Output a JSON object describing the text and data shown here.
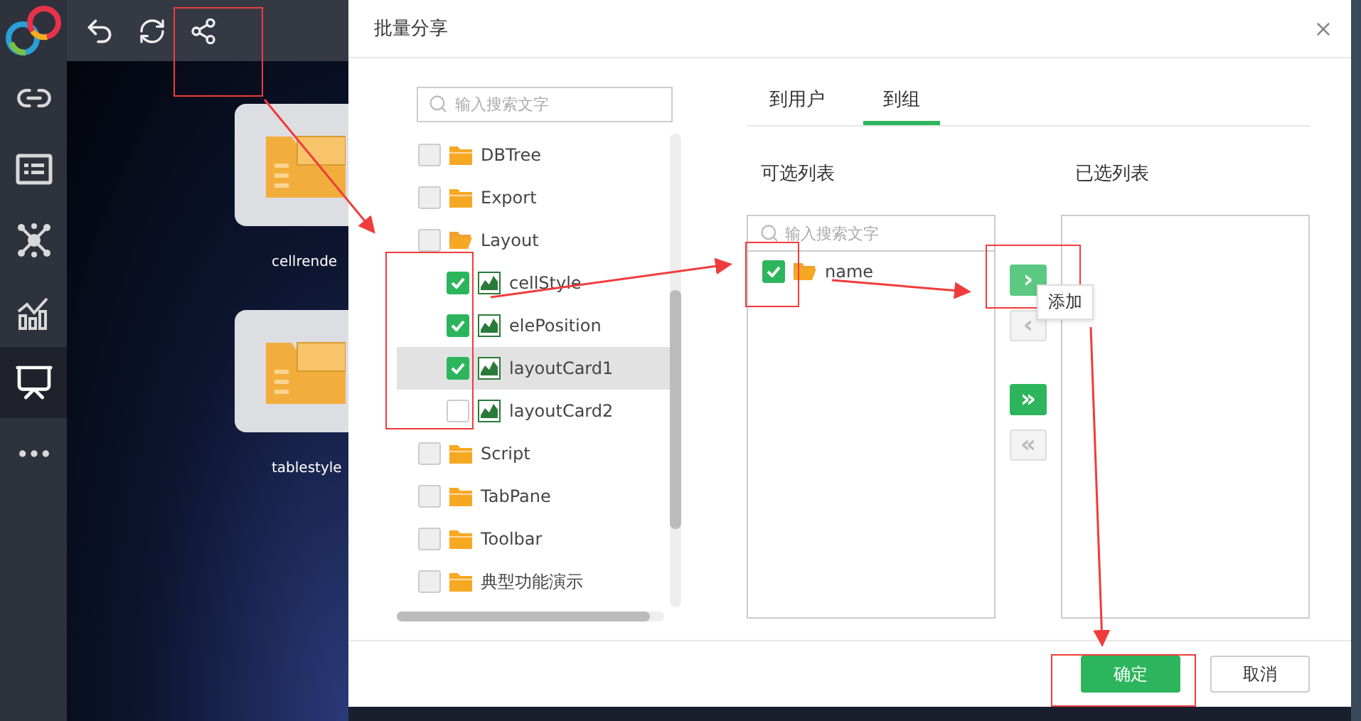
{
  "sidebar": {
    "items": [
      {
        "kind": "link",
        "selected": false
      },
      {
        "kind": "form",
        "selected": false
      },
      {
        "kind": "network",
        "selected": false
      },
      {
        "kind": "chart",
        "selected": false
      },
      {
        "kind": "presentation",
        "selected": true
      },
      {
        "kind": "more",
        "selected": false
      }
    ]
  },
  "canvas": {
    "cards": [
      {
        "label": "cellrende"
      },
      {
        "label": "tablestyle"
      }
    ]
  },
  "dialog": {
    "title": "批量分享",
    "tree": {
      "placeholder": "输入搜索文字",
      "items": [
        {
          "label": "DBTree",
          "kind": "folder",
          "checked": false,
          "expanded": false,
          "selected": false
        },
        {
          "label": "Export",
          "kind": "folder",
          "checked": false,
          "expanded": false,
          "selected": false
        },
        {
          "label": "Layout",
          "kind": "folder",
          "checked": false,
          "expanded": true,
          "selected": false,
          "children": [
            {
              "label": "cellStyle",
              "kind": "report",
              "checked": true,
              "selected": false
            },
            {
              "label": "elePosition",
              "kind": "report",
              "checked": true,
              "selected": false
            },
            {
              "label": "layoutCard1",
              "kind": "report",
              "checked": true,
              "selected": true
            },
            {
              "label": "layoutCard2",
              "kind": "report",
              "checked": false,
              "selected": false
            }
          ]
        },
        {
          "label": "Script",
          "kind": "folder",
          "checked": false,
          "expanded": false,
          "selected": false
        },
        {
          "label": "TabPane",
          "kind": "folder",
          "checked": false,
          "expanded": false,
          "selected": false
        },
        {
          "label": "Toolbar",
          "kind": "folder",
          "checked": false,
          "expanded": false,
          "selected": false
        },
        {
          "label": "典型功能演示",
          "kind": "folder",
          "checked": false,
          "expanded": false,
          "selected": false
        }
      ]
    },
    "tabs": [
      {
        "label": "到用户",
        "selected": false
      },
      {
        "label": "到组",
        "selected": true
      }
    ],
    "available": {
      "title": "可选列表",
      "placeholder": "输入搜索文字",
      "items": [
        {
          "label": "name",
          "checked": true
        }
      ]
    },
    "transfer_buttons": [
      {
        "glyph": "›",
        "disabled": false,
        "hovered": true
      },
      {
        "glyph": "‹",
        "disabled": true,
        "hovered": false
      },
      {
        "glyph": "»",
        "disabled": false,
        "hovered": false
      },
      {
        "glyph": "«",
        "disabled": true,
        "hovered": false
      }
    ],
    "tooltip": "添加",
    "chosen": {
      "title": "已选列表"
    },
    "buttons": [
      {
        "label": "确定",
        "kind": "primary"
      },
      {
        "label": "取消",
        "kind": "default"
      }
    ]
  }
}
